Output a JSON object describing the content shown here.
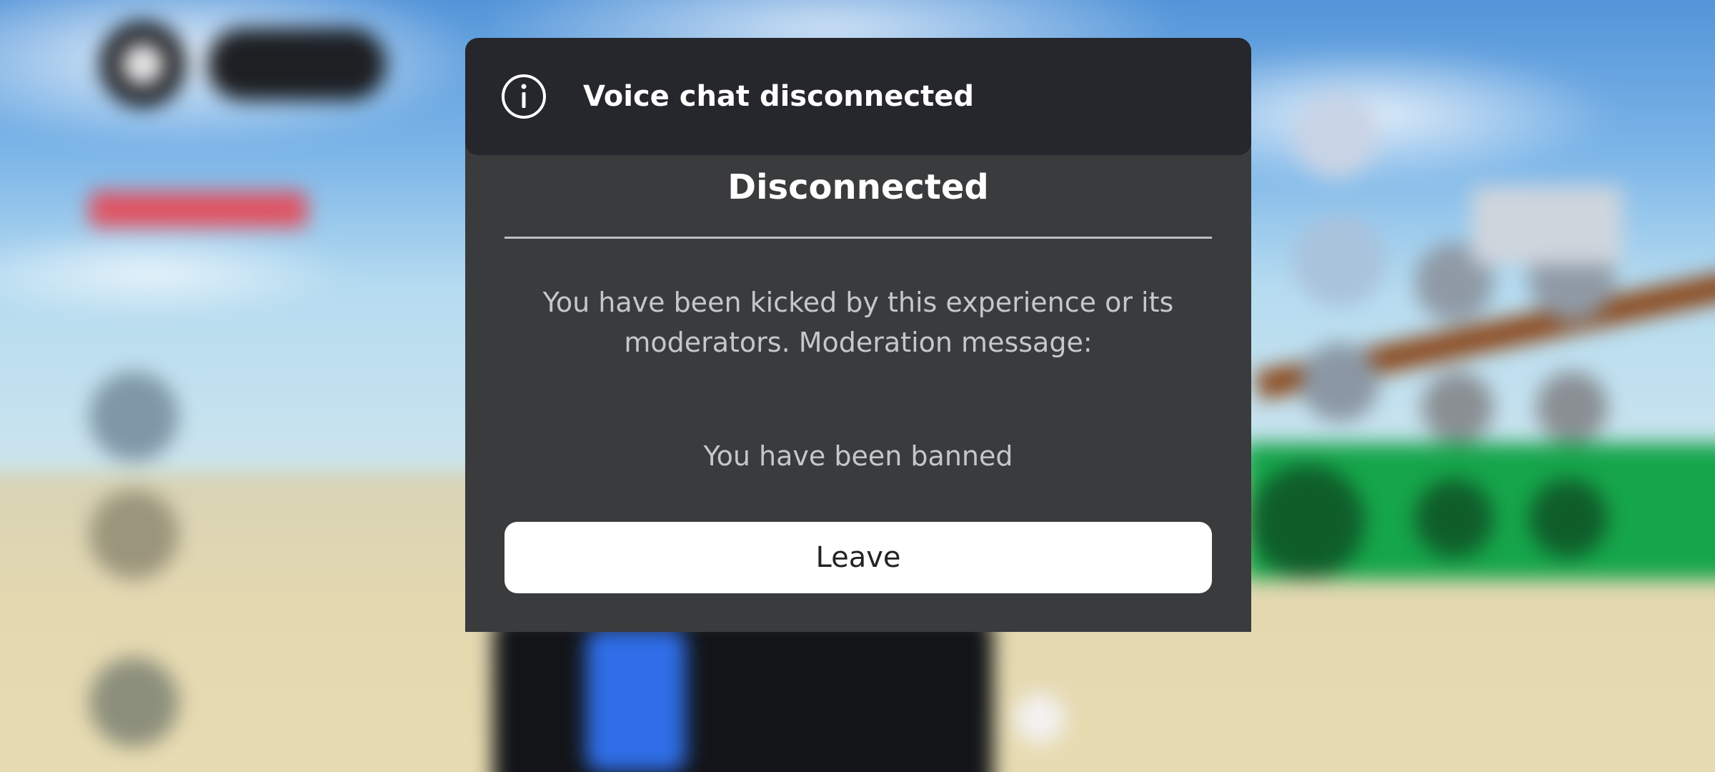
{
  "toast": {
    "icon": "info-icon",
    "text": "Voice chat disconnected"
  },
  "modal": {
    "title": "Disconnected",
    "message": "You have been kicked by this experience or its moderators. Moderation message:",
    "reason": "You have been banned",
    "leave_label": "Leave"
  },
  "colors": {
    "toast_bg": "#25272c",
    "modal_bg": "#393b3d",
    "button_bg": "#ffffff",
    "body_text": "#c6c7c8"
  }
}
